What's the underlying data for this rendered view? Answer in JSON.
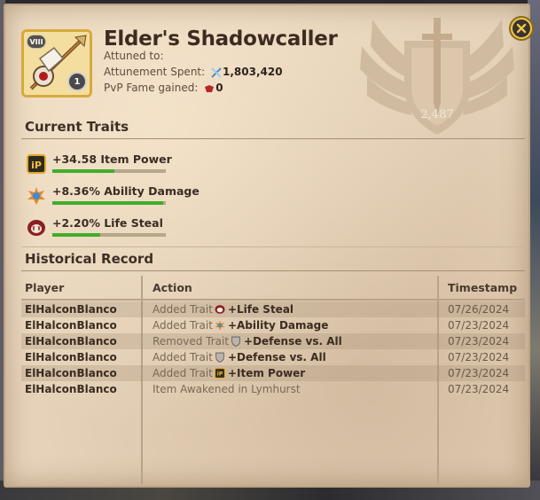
{
  "item": {
    "name": "Elder's Shadowcaller",
    "tier": "VIII",
    "enchantment": "1",
    "attuned_label": "Attuned to:",
    "attunement_label": "Attunement Spent:",
    "attunement_value": "1,803,420",
    "pvp_fame_label": "PvP Fame gained:",
    "pvp_fame_value": "0",
    "crest_value": "2,487"
  },
  "current_traits": {
    "title": "Current Traits",
    "items": [
      {
        "icon": "item-power-icon",
        "label": "+34.58 Item Power",
        "progress": 0.55
      },
      {
        "icon": "ability-damage-icon",
        "label": "+8.36% Ability Damage",
        "progress": 0.98
      },
      {
        "icon": "life-steal-icon",
        "label": "+2.20% Life Steal",
        "progress": 0.42
      }
    ]
  },
  "history": {
    "title": "Historical Record",
    "columns": {
      "player": "Player",
      "action": "Action",
      "timestamp": "Timestamp"
    },
    "rows": [
      {
        "player": "ElHalconBlanco",
        "action": "Added Trait",
        "icon": "life-steal-icon",
        "trait": "+Life Steal",
        "timestamp": "07/26/2024"
      },
      {
        "player": "ElHalconBlanco",
        "action": "Added Trait",
        "icon": "ability-damage-icon",
        "trait": "+Ability Damage",
        "timestamp": "07/23/2024"
      },
      {
        "player": "ElHalconBlanco",
        "action": "Removed Trait",
        "icon": "shield-icon",
        "trait": "+Defense vs. All",
        "timestamp": "07/23/2024"
      },
      {
        "player": "ElHalconBlanco",
        "action": "Added Trait",
        "icon": "shield-icon",
        "trait": "+Defense vs. All",
        "timestamp": "07/23/2024"
      },
      {
        "player": "ElHalconBlanco",
        "action": "Added Trait",
        "icon": "item-power-icon",
        "trait": "+Item Power",
        "timestamp": "07/23/2024"
      },
      {
        "player": "ElHalconBlanco",
        "action": "Item Awakened in Lymhurst",
        "icon": "",
        "trait": "",
        "timestamp": "07/23/2024"
      }
    ]
  },
  "colors": {
    "parchment": "#e7d4bb",
    "progress_green": "#3fae2c",
    "close_gold": "#f0c64a"
  }
}
